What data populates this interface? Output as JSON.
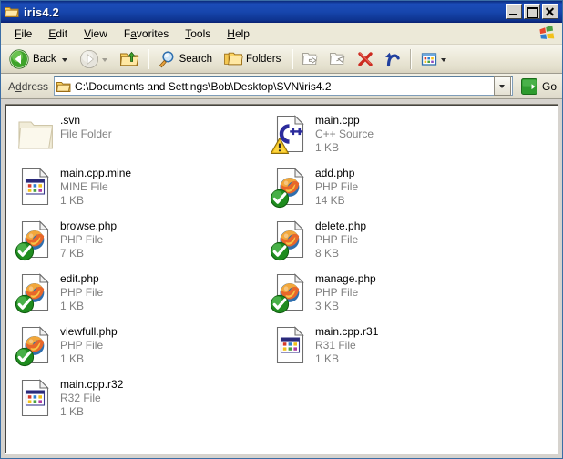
{
  "window": {
    "title": "iris4.2",
    "title_icon": "folder-icon",
    "buttons": {
      "minimize": "Minimize",
      "maximize": "Maximize",
      "close": "Close"
    }
  },
  "menubar": {
    "items": [
      {
        "label": "File",
        "accel": "F"
      },
      {
        "label": "Edit",
        "accel": "E"
      },
      {
        "label": "View",
        "accel": "V"
      },
      {
        "label": "Favorites",
        "accel": "a"
      },
      {
        "label": "Tools",
        "accel": "T"
      },
      {
        "label": "Help",
        "accel": "H"
      }
    ],
    "logo": "windows-flag-icon"
  },
  "toolbar": {
    "back_label": "Back",
    "back_icon": "back-arrow-icon",
    "forward_icon": "forward-arrow-icon",
    "up_icon": "up-folder-icon",
    "search_label": "Search",
    "search_icon": "magnifier-icon",
    "folders_label": "Folders",
    "folders_icon": "folders-icon",
    "move_to_icon": "move-to-folder-icon",
    "copy_to_icon": "copy-to-folder-icon",
    "delete_icon": "delete-x-icon",
    "undo_icon": "undo-arrow-icon",
    "views_icon": "views-icon"
  },
  "address": {
    "label": "Address",
    "accel": "d",
    "value": "C:\\Documents and Settings\\Bob\\Desktop\\SVN\\iris4.2",
    "placeholder": "",
    "folder_icon": "folder-icon",
    "dropdown_icon": "chevron-down-icon",
    "go_label": "Go",
    "go_icon": "go-arrow-icon"
  },
  "files": [
    {
      "name": ".svn",
      "type": "File Folder",
      "size": "",
      "icon": "folder-dimmed-icon",
      "overlay": "none"
    },
    {
      "name": "main.cpp.mine",
      "type": "MINE File",
      "size": "1 KB",
      "icon": "generic-file-icon",
      "overlay": "none"
    },
    {
      "name": "browse.php",
      "type": "PHP File",
      "size": "7 KB",
      "icon": "firefox-file-icon",
      "overlay": "green-check"
    },
    {
      "name": "edit.php",
      "type": "PHP File",
      "size": "1 KB",
      "icon": "firefox-file-icon",
      "overlay": "green-check"
    },
    {
      "name": "viewfull.php",
      "type": "PHP File",
      "size": "1 KB",
      "icon": "firefox-file-icon",
      "overlay": "green-check"
    },
    {
      "name": "main.cpp.r32",
      "type": "R32 File",
      "size": "1 KB",
      "icon": "generic-file-icon",
      "overlay": "none"
    },
    {
      "name": "main.cpp",
      "type": "C++ Source",
      "size": "1 KB",
      "icon": "cpp-file-icon",
      "overlay": "warning-triangle"
    },
    {
      "name": "add.php",
      "type": "PHP File",
      "size": "14 KB",
      "icon": "firefox-file-icon",
      "overlay": "green-check"
    },
    {
      "name": "delete.php",
      "type": "PHP File",
      "size": "8 KB",
      "icon": "firefox-file-icon",
      "overlay": "green-check"
    },
    {
      "name": "manage.php",
      "type": "PHP File",
      "size": "3 KB",
      "icon": "firefox-file-icon",
      "overlay": "green-check"
    },
    {
      "name": "main.cpp.r31",
      "type": "R31 File",
      "size": "1 KB",
      "icon": "generic-file-icon",
      "overlay": "none"
    }
  ],
  "colors": {
    "titlebar": "#1746ad",
    "toolbar": "#ece9d8",
    "accent_green": "#2e9b2e",
    "delete_red": "#cc2b20",
    "undo_blue": "#1f3f9e",
    "text_gray": "#808080"
  }
}
